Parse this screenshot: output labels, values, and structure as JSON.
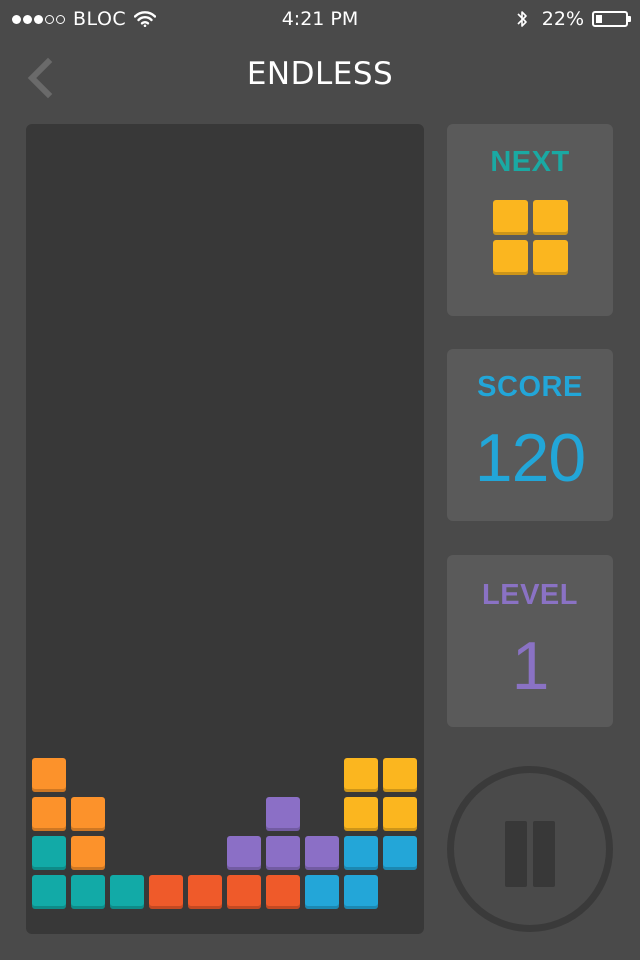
{
  "status_bar": {
    "carrier": "BLOC",
    "signal_bars_filled": 3,
    "signal_bars_total": 5,
    "time": "4:21 PM",
    "battery_percent": "22%",
    "battery_level": 0.22,
    "icons": [
      "wifi-icon",
      "bluetooth-icon",
      "battery-icon"
    ]
  },
  "header": {
    "title": "ENDLESS",
    "back_icon": "chevron-left-icon"
  },
  "next_panel": {
    "label": "NEXT",
    "label_color": "#1aa9a3",
    "piece": "O",
    "piece_color": "#fbb61f"
  },
  "score_panel": {
    "label": "SCORE",
    "value": "120",
    "color": "#22a6d8"
  },
  "level_panel": {
    "label": "LEVEL",
    "value": "1",
    "color": "#8a72c4"
  },
  "pause_button": {
    "icon": "pause-icon"
  },
  "board": {
    "columns": 10,
    "rows": 20,
    "colors": {
      "L": "#fc922b",
      "I": "#12aaa7",
      "Z": "#ef5a2a",
      "T": "#8b6fc6",
      "J": "#23a6d8",
      "O": "#fbb61f"
    },
    "cells": [
      {
        "row": 16,
        "col": 0,
        "piece": "L"
      },
      {
        "row": 16,
        "col": 8,
        "piece": "O"
      },
      {
        "row": 16,
        "col": 9,
        "piece": "O"
      },
      {
        "row": 17,
        "col": 0,
        "piece": "L"
      },
      {
        "row": 17,
        "col": 1,
        "piece": "L"
      },
      {
        "row": 17,
        "col": 6,
        "piece": "T"
      },
      {
        "row": 17,
        "col": 8,
        "piece": "O"
      },
      {
        "row": 17,
        "col": 9,
        "piece": "O"
      },
      {
        "row": 18,
        "col": 0,
        "piece": "I"
      },
      {
        "row": 18,
        "col": 1,
        "piece": "L"
      },
      {
        "row": 18,
        "col": 5,
        "piece": "T"
      },
      {
        "row": 18,
        "col": 6,
        "piece": "T"
      },
      {
        "row": 18,
        "col": 7,
        "piece": "T"
      },
      {
        "row": 18,
        "col": 8,
        "piece": "J"
      },
      {
        "row": 18,
        "col": 9,
        "piece": "J"
      },
      {
        "row": 19,
        "col": 0,
        "piece": "I"
      },
      {
        "row": 19,
        "col": 1,
        "piece": "I"
      },
      {
        "row": 19,
        "col": 2,
        "piece": "I"
      },
      {
        "row": 19,
        "col": 3,
        "piece": "Z"
      },
      {
        "row": 19,
        "col": 4,
        "piece": "Z"
      },
      {
        "row": 19,
        "col": 5,
        "piece": "Z"
      },
      {
        "row": 19,
        "col": 6,
        "piece": "Z"
      },
      {
        "row": 19,
        "col": 7,
        "piece": "J"
      },
      {
        "row": 19,
        "col": 8,
        "piece": "J"
      }
    ]
  }
}
